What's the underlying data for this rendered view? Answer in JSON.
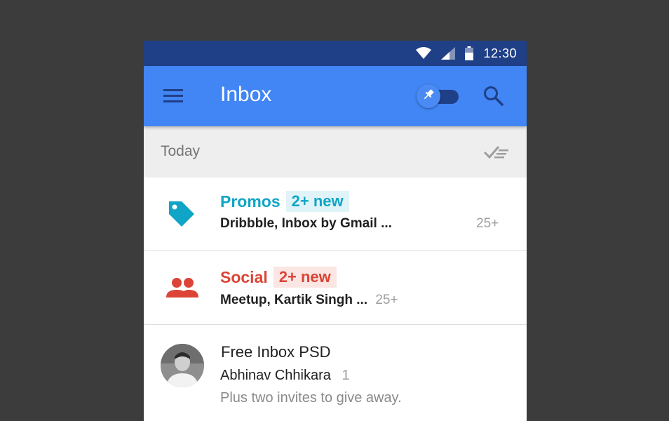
{
  "status_bar": {
    "time": "12:30"
  },
  "toolbar": {
    "title": "Inbox"
  },
  "section": {
    "label": "Today"
  },
  "bundles": [
    {
      "name": "Promos",
      "badge": "2+ new",
      "senders": "Dribbble, Inbox by Gmail ...",
      "count": "25+",
      "color": "#10a5c6",
      "badge_bg": "#e0f3f8",
      "icon": "tag-icon"
    },
    {
      "name": "Social",
      "badge": "2+ new",
      "senders": "Meetup, Kartik Singh ...",
      "count": "25+",
      "color": "#db4437",
      "badge_bg": "#fbe6e4",
      "icon": "people-icon"
    }
  ],
  "email": {
    "subject": "Free Inbox PSD",
    "from": "Abhinav Chhikara",
    "thread_count": "1",
    "snippet": "Plus two invites to give away."
  },
  "colors": {
    "background": "#3c3c3c",
    "status_bar": "#1f3f86",
    "toolbar": "#4285f4",
    "section_header": "#eeeeee"
  }
}
